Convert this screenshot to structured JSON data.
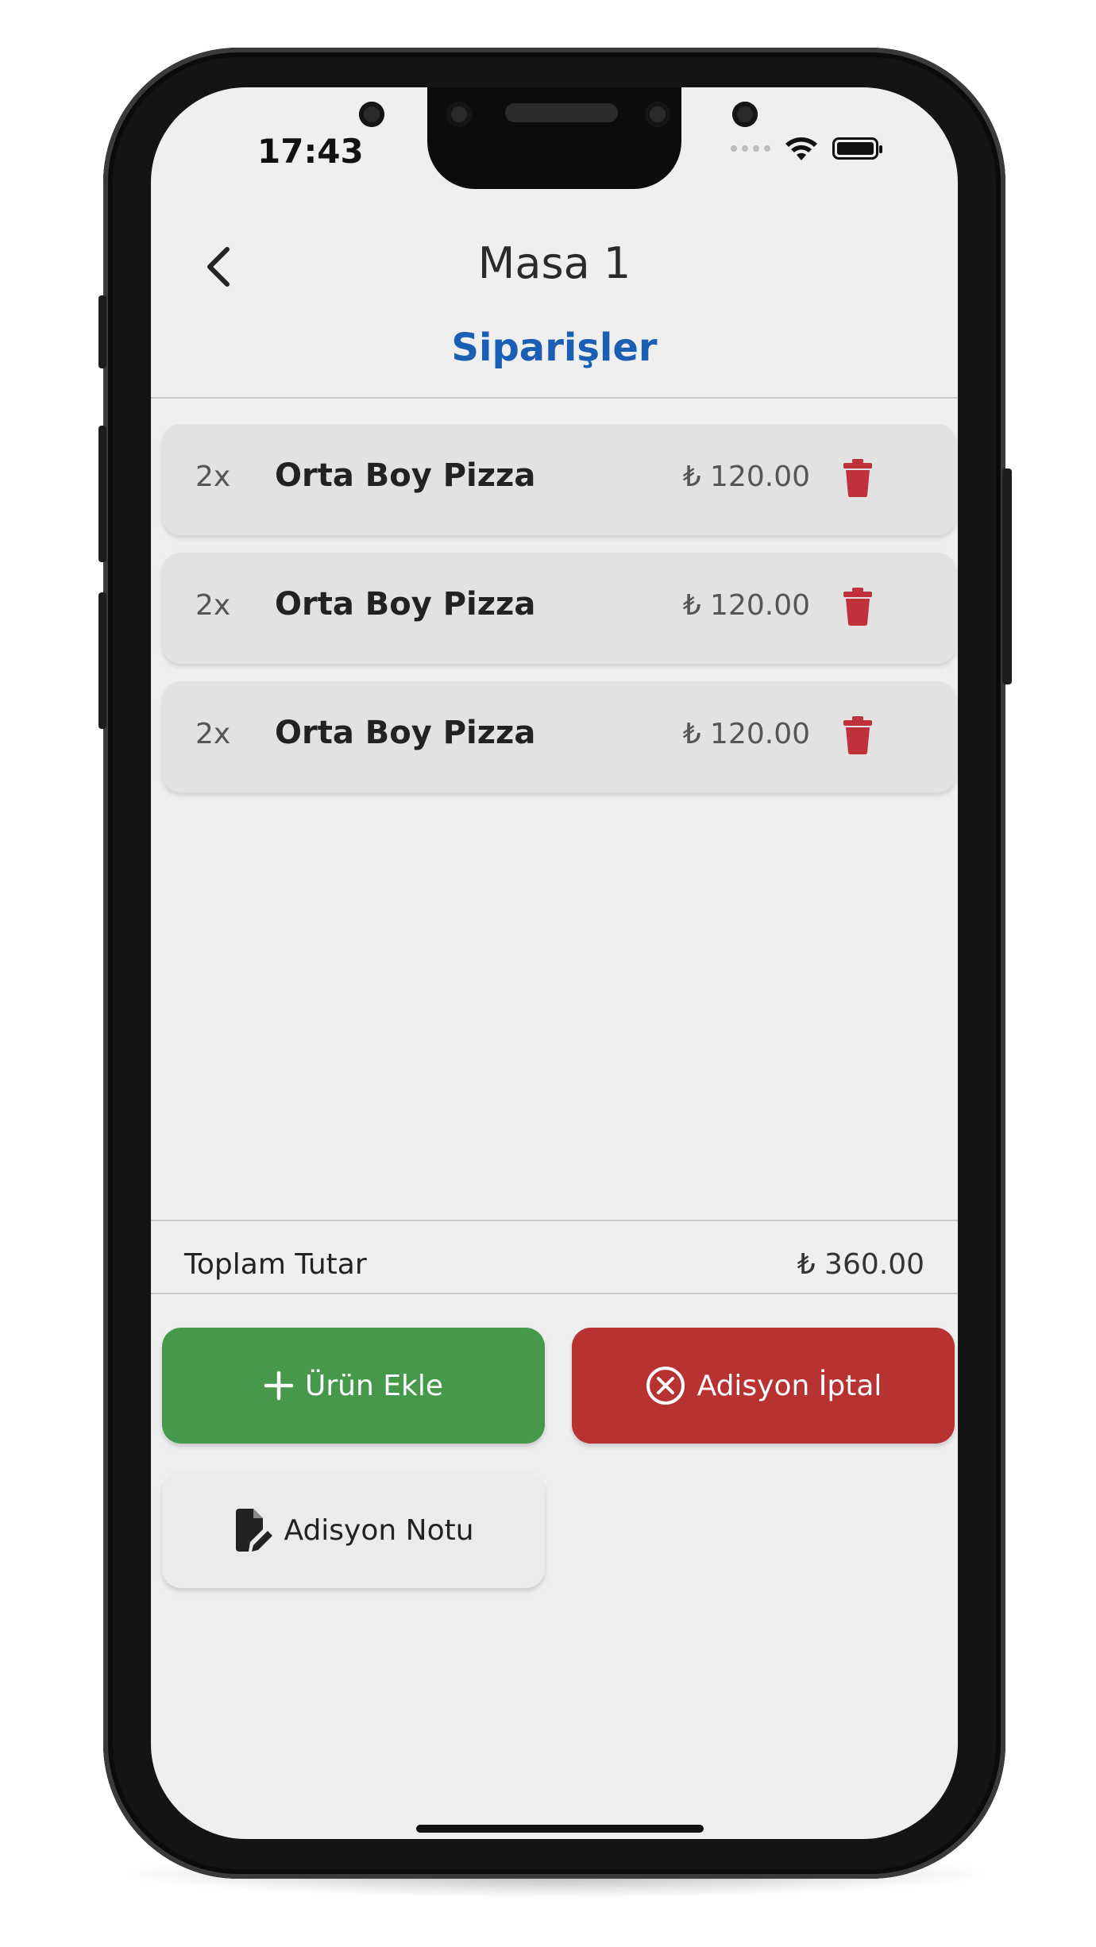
{
  "status_bar": {
    "time": "17:43"
  },
  "header": {
    "title": "Masa 1",
    "subtitle": "Siparişler"
  },
  "orders": [
    {
      "qty": "2x",
      "name": "Orta Boy Pizza",
      "price": "₺ 120.00"
    },
    {
      "qty": "2x",
      "name": "Orta Boy Pizza",
      "price": "₺ 120.00"
    },
    {
      "qty": "2x",
      "name": "Orta Boy Pizza",
      "price": "₺ 120.00"
    }
  ],
  "total": {
    "label": "Toplam Tutar",
    "value": "₺ 360.00"
  },
  "actions": {
    "add_product": "Ürün Ekle",
    "cancel_bill": "Adisyon İptal",
    "bill_note": "Adisyon Notu"
  },
  "icons": {
    "back": "chevron-left-icon",
    "delete": "trash-icon",
    "add": "plus-icon",
    "cancel": "close-circle-icon",
    "note": "note-edit-icon"
  },
  "colors": {
    "accent_blue": "#1a5fb4",
    "green": "#46994b",
    "red": "#b83232",
    "trash_red": "#c0313a"
  }
}
